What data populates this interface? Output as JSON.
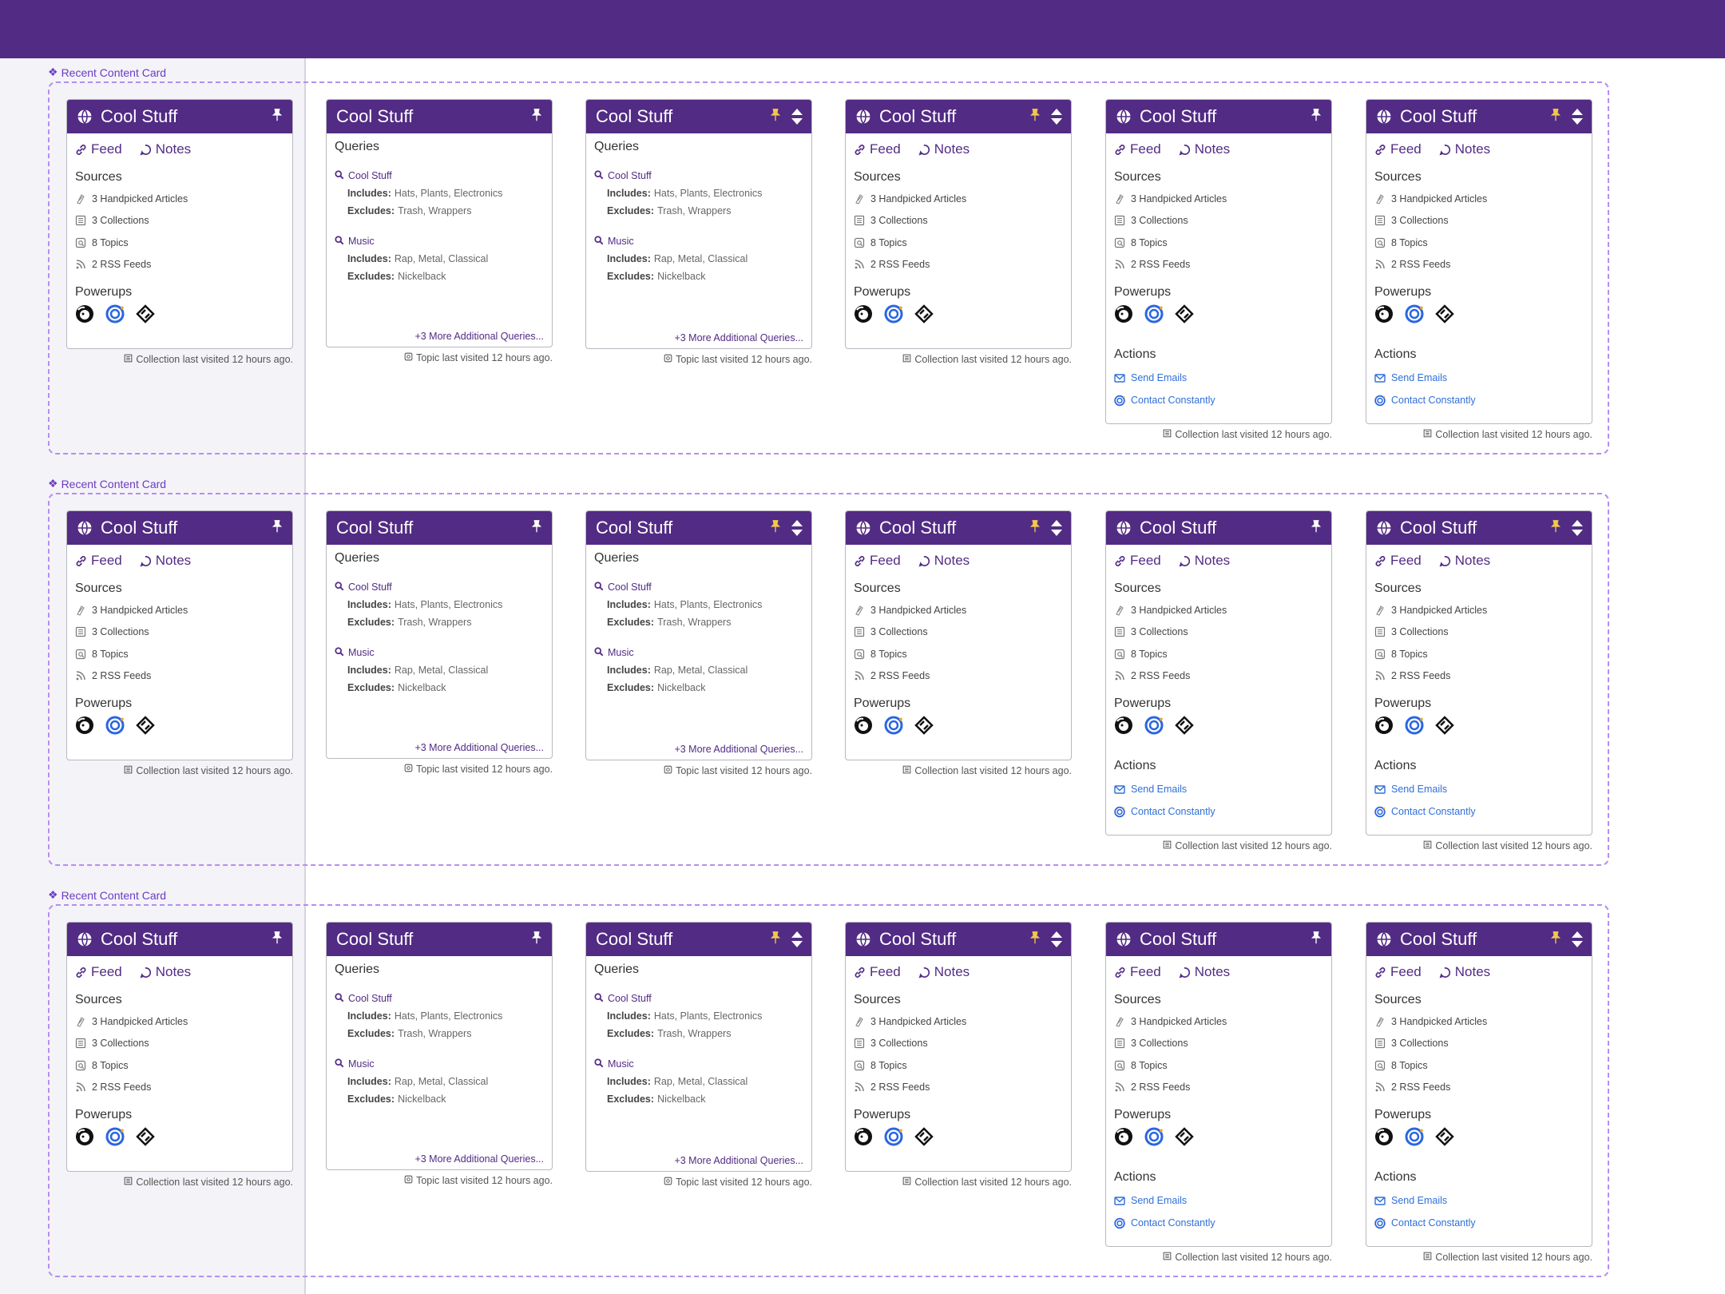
{
  "section_label": "Recent Content Card",
  "card": {
    "title": "Cool Stuff",
    "feed_label": "Feed",
    "notes_label": "Notes",
    "sources_title": "Sources",
    "sources": [
      {
        "icon": "article-icon",
        "label": "3 Handpicked Articles"
      },
      {
        "icon": "collection-icon",
        "label": "3 Collections"
      },
      {
        "icon": "topic-icon",
        "label": "8 Topics"
      },
      {
        "icon": "rss-icon",
        "label": "2 RSS Feeds"
      }
    ],
    "powerups_title": "Powerups",
    "powerups": [
      "mailchimp-icon",
      "constant-contact-icon",
      "zapier-icon"
    ],
    "actions_title": "Actions",
    "actions": [
      {
        "icon": "mail-icon",
        "label": "Send Emails"
      },
      {
        "icon": "constant-contact-icon",
        "label": "Contact Constantly"
      }
    ],
    "queries_title": "Queries",
    "queries": [
      {
        "name": "Cool Stuff",
        "includes": "Hats, Plants, Electronics",
        "excludes": "Trash, Wrappers"
      },
      {
        "name": "Music",
        "includes": "Rap, Metal, Classical",
        "excludes": "Nickelback"
      }
    ],
    "includes_label": "Includes:",
    "excludes_label": "Excludes:",
    "more_queries": "+3 More Additional Queries...",
    "footer_collection": "Collection last visited 12 hours ago.",
    "footer_topic": "Topic last visited 12 hours ago."
  },
  "colors": {
    "brand": "#522b84",
    "pin_active": "#f3c84a",
    "link": "#2f6fd8",
    "dashed_frame": "#b58ef0"
  }
}
